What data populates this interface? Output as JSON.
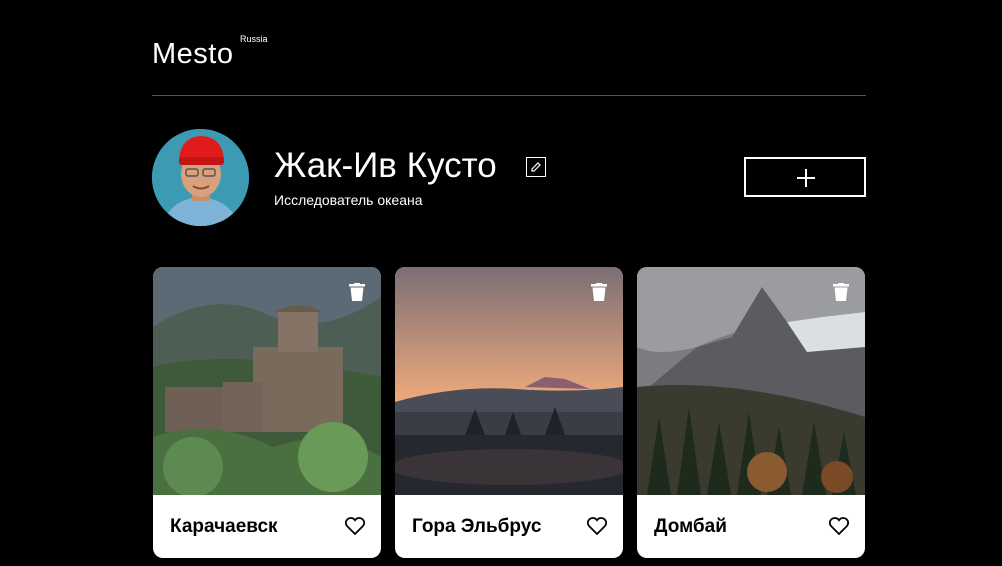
{
  "header": {
    "logo": "Mesto",
    "logo_sup": "Russia"
  },
  "profile": {
    "name": "Жак-Ив Кусто",
    "description": "Исследователь океана"
  },
  "cards": [
    {
      "title": "Карачаевск"
    },
    {
      "title": "Гора Эльбрус"
    },
    {
      "title": "Домбай"
    }
  ],
  "icons": {
    "edit": "pencil-icon",
    "add": "plus-icon",
    "delete": "trash-icon",
    "like": "heart-icon"
  },
  "colors": {
    "background": "#000000",
    "card": "#ffffff",
    "divider": "#545454"
  }
}
